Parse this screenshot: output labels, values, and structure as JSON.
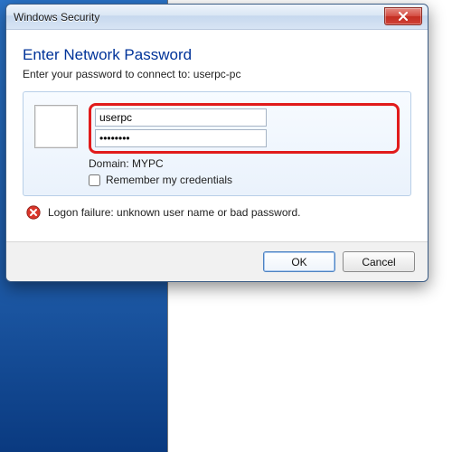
{
  "window": {
    "title": "Windows Security"
  },
  "dialog": {
    "title": "Enter Network Password",
    "subtitle": "Enter your password to connect to: userpc-pc"
  },
  "credentials": {
    "username_value": "userpc",
    "password_value": "••••••••",
    "domain_label": "Domain: MYPC",
    "remember_label": "Remember my credentials",
    "remember_checked": false
  },
  "error": {
    "message": "Logon failure: unknown user name or bad password."
  },
  "buttons": {
    "ok": "OK",
    "cancel": "Cancel"
  }
}
